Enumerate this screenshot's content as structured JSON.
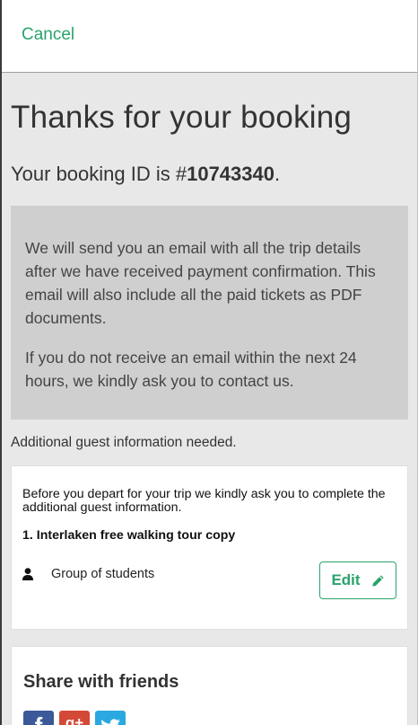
{
  "header": {
    "cancel_label": "Cancel"
  },
  "main": {
    "title": "Thanks for your booking",
    "booking_id_prefix": "Your booking ID is #",
    "booking_id": "10743340",
    "booking_id_suffix": ".",
    "notice": {
      "paragraph1": "We will send you an email with all the trip details after we have received payment confirmation. This email will also include all the paid tickets as PDF documents.",
      "paragraph2": "If you do not receive an email within the next 24 hours, we kindly ask you to contact us."
    },
    "additional_info": "Additional guest information needed."
  },
  "guest_card": {
    "instruction": "Before you depart for your trip we kindly ask you to complete the additional guest information.",
    "tour_name": "1. Interlaken free walking tour copy",
    "guest_label": "Group of students",
    "guest_icon": "person-icon",
    "edit_label": "Edit",
    "edit_icon": "pencil-icon"
  },
  "share": {
    "title": "Share with friends",
    "buttons": [
      {
        "label": "f",
        "icon": "facebook-icon",
        "color": "#3b5998"
      },
      {
        "label": "g+",
        "icon": "google-plus-icon",
        "color": "#d34836"
      },
      {
        "label": "",
        "icon": "twitter-icon",
        "color": "#2aa9e0"
      }
    ]
  },
  "colors": {
    "accent": "#2aa36b",
    "notice_bg": "#cfcfcf",
    "page_bg": "#e8e8e8"
  }
}
